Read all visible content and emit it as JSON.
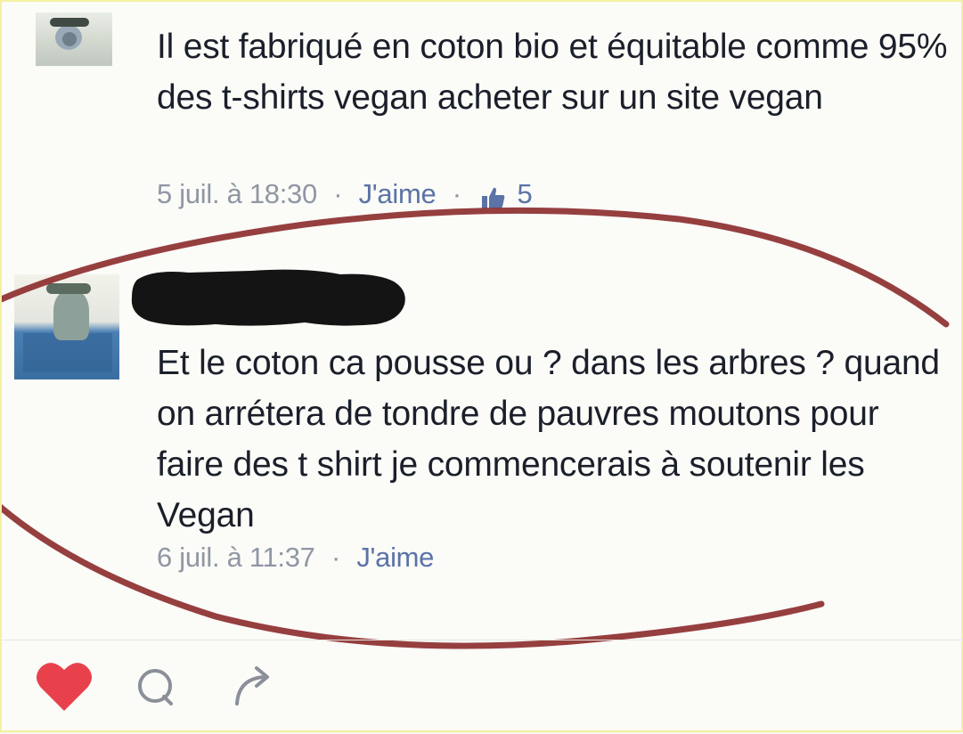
{
  "comments": [
    {
      "text": "Il est fabriqué en coton bio et équitable comme 95% des t-shirts vegan acheter sur un site vegan",
      "timestamp": "5 juil. à 18:30",
      "separator": "·",
      "like_label": "J'aime",
      "like_count": "5",
      "avatar_icon": "user-avatar"
    },
    {
      "author_redacted": true,
      "text": "Et le coton ca pousse ou ? dans les arbres ? quand on arrétera de tondre de pauvres moutons pour faire des t shirt je commencerais à soutenir les Vegan",
      "timestamp": "6 juil. à 11:37",
      "separator": "·",
      "like_label": "J'aime",
      "avatar_icon": "user-avatar"
    }
  ],
  "footer": {
    "icons": [
      "heart-icon",
      "comment-icon",
      "share-icon"
    ],
    "heart_color": "#e8414b"
  },
  "annotation_color": "#8b2a2a"
}
